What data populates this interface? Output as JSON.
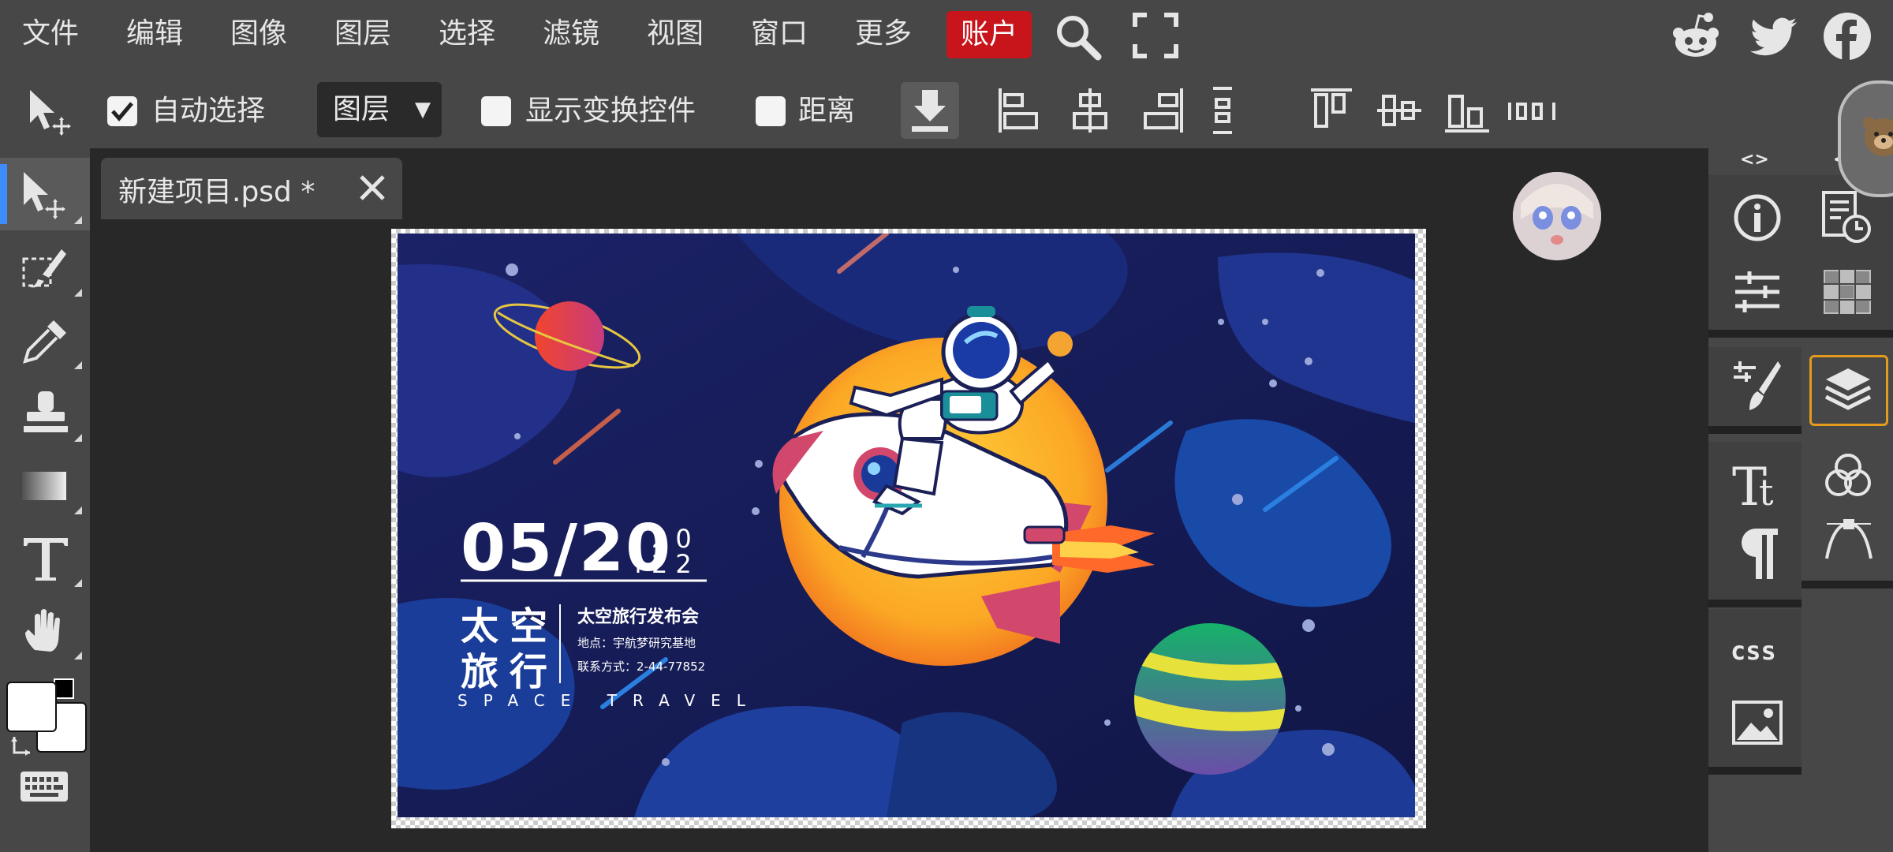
{
  "menubar": {
    "items": [
      "文件",
      "编辑",
      "图像",
      "图层",
      "选择",
      "滤镜",
      "视图",
      "窗口",
      "更多"
    ],
    "account": "账户"
  },
  "options": {
    "auto_select": "自动选择",
    "auto_select_checked": true,
    "target_select": "图层",
    "show_transform": "显示变换控件",
    "distance": "距离"
  },
  "document": {
    "tab_title": "新建项目.psd *"
  },
  "artwork": {
    "date": "05/20",
    "year_top": "20",
    "year_bottom": "22",
    "title_line1": "太空",
    "title_line2": "旅行",
    "event": "太空旅行发布会",
    "location": "地点：宇航梦研究基地",
    "contact": "联系方式：2-44-77852",
    "english": "SPACE TRAVEL"
  },
  "panels": {
    "arrows": "<>",
    "css_label": "css"
  },
  "colors": {
    "accent_active_tool": "#3f8cff",
    "account_bg": "#c8151b",
    "layers_highlight": "#e39a1d"
  }
}
